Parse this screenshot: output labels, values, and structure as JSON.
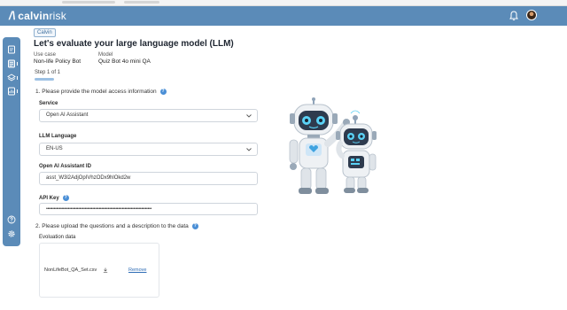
{
  "app": {
    "logo_mark": "/\\",
    "logo_bold": "calvin",
    "logo_light": "risk"
  },
  "breadcrumb": "Calvin",
  "page_title": "Let's evaluate your large language model (LLM)",
  "meta": {
    "use_case_label": "Use case",
    "use_case_value": "Non-life Policy Bot",
    "model_label": "Model",
    "model_value": "Quiz Bot 4o mini QA"
  },
  "step": {
    "label": "Step 1 of 1",
    "progress": 1.0
  },
  "section1": {
    "title": "1. Please provide the model access information",
    "service_label": "Service",
    "service_value": "Open AI Assistant",
    "language_label": "LLM Language",
    "language_value": "EN-US",
    "assistant_id_label": "Open AI Assistant ID",
    "assistant_id_value": "asst_W3l2AdjOpIVhzODx9hlOkd2w",
    "api_key_label": "API Key",
    "api_key_value": "••••••••••••••••••••••••••••••••••••••••••••••••••••••••••••••••••••••••••••••••••"
  },
  "section2": {
    "title": "2. Please upload the questions and a description to the data",
    "upload_label": "Evoluation data",
    "file_name": "NonLifeBot_QA_Set.csv",
    "remove_label": "Remove"
  },
  "colors": {
    "brand_blue": "#5b8bb8",
    "link": "#2f6db5",
    "help": "#4a8fd6"
  },
  "icons": [
    "bell-icon",
    "document-icon",
    "notes-icon",
    "layers-icon",
    "chart-icon",
    "help-icon",
    "settings-icon",
    "download-icon",
    "chevron-down-icon"
  ]
}
